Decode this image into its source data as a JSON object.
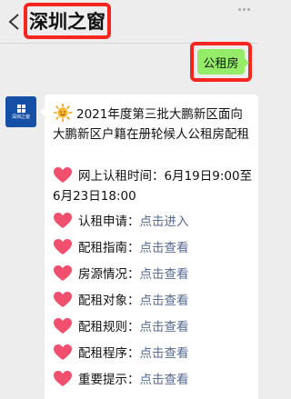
{
  "header": {
    "title": "深圳之窗"
  },
  "outgoing": {
    "text": "公租房"
  },
  "avatar": {
    "label": "深圳之窗"
  },
  "message": {
    "intro": "2021年度第三批大鹏新区面向大鹏新区户籍在册轮候人公租房配租",
    "time_line": "网上认租时间：6月19日9:00至6月23日18:00",
    "items": [
      {
        "label": "认租申请：",
        "link": "点击进入"
      },
      {
        "label": "配租指南：",
        "link": "点击查看"
      },
      {
        "label": "房源情况：",
        "link": "点击查看"
      },
      {
        "label": "配租对象：",
        "link": "点击查看"
      },
      {
        "label": "配租规则：",
        "link": "点击查看"
      },
      {
        "label": "配租程序：",
        "link": "点击查看"
      },
      {
        "label": "重要提示：",
        "link": "点击查看"
      }
    ]
  },
  "colors": {
    "highlight": "#f4261f",
    "outgoing_bubble": "#95ec69",
    "link": "#576b95",
    "heart": "#f0506e",
    "avatar": "#1650a6"
  }
}
